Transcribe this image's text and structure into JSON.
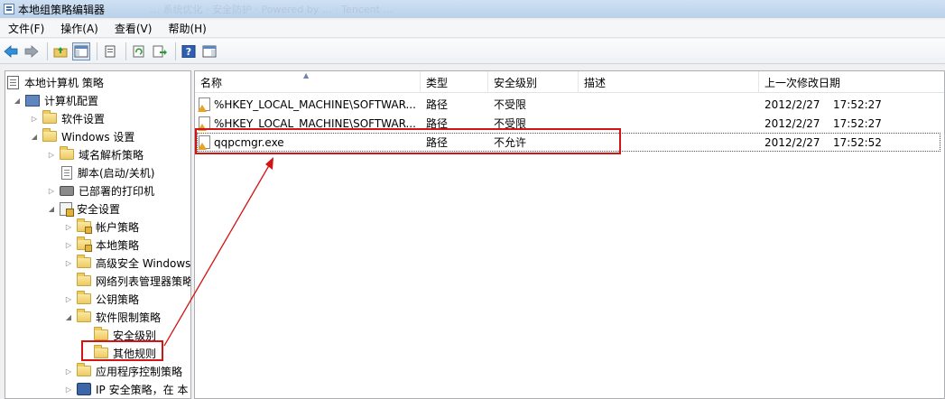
{
  "window": {
    "title": "本地组策略编辑器",
    "ghost_text": "… 系统优化 · 安全防护 · Powered by … · Tencent …"
  },
  "menu": [
    {
      "label": "文件(F)"
    },
    {
      "label": "操作(A)"
    },
    {
      "label": "查看(V)"
    },
    {
      "label": "帮助(H)"
    }
  ],
  "toolbar": {
    "icons": [
      "back-arrow-icon",
      "forward-arrow-icon",
      "up-folder-icon",
      "show-hide-tree-icon",
      "properties-icon",
      "refresh-icon",
      "export-list-icon",
      "help-icon",
      "show-hide-action-pane-icon"
    ]
  },
  "tree": {
    "root": "本地计算机 策略",
    "computer_config": "计算机配置",
    "software_settings": "软件设置",
    "windows_settings": "Windows 设置",
    "dns_policy": "域名解析策略",
    "scripts": "脚本(启动/关机)",
    "deployed_printers": "已部署的打印机",
    "security_settings": "安全设置",
    "account_policies": "帐户策略",
    "local_policies": "本地策略",
    "advanced_firewall": "高级安全 Windows",
    "network_list": "网络列表管理器策略",
    "public_key": "公钥策略",
    "software_restriction": "软件限制策略",
    "security_levels": "安全级别",
    "additional_rules": "其他规则",
    "app_control": "应用程序控制策略",
    "ipsec": "IP 安全策略，在 本"
  },
  "list": {
    "columns": [
      "名称",
      "类型",
      "安全级别",
      "描述",
      "上一次修改日期"
    ],
    "rows": [
      {
        "name": "%HKEY_LOCAL_MACHINE\\SOFTWAR...",
        "type": "路径",
        "level": "不受限",
        "desc": "",
        "date": "2012/2/27",
        "time": "17:52:27"
      },
      {
        "name": "%HKEY_LOCAL_MACHINE\\SOFTWAR...",
        "type": "路径",
        "level": "不受限",
        "desc": "",
        "date": "2012/2/27",
        "time": "17:52:27"
      },
      {
        "name": "qqpcmgr.exe",
        "type": "路径",
        "level": "不允许",
        "desc": "",
        "date": "2012/2/27",
        "time": "17:52:52"
      }
    ]
  },
  "colors": {
    "annotation_red": "#d21414"
  }
}
